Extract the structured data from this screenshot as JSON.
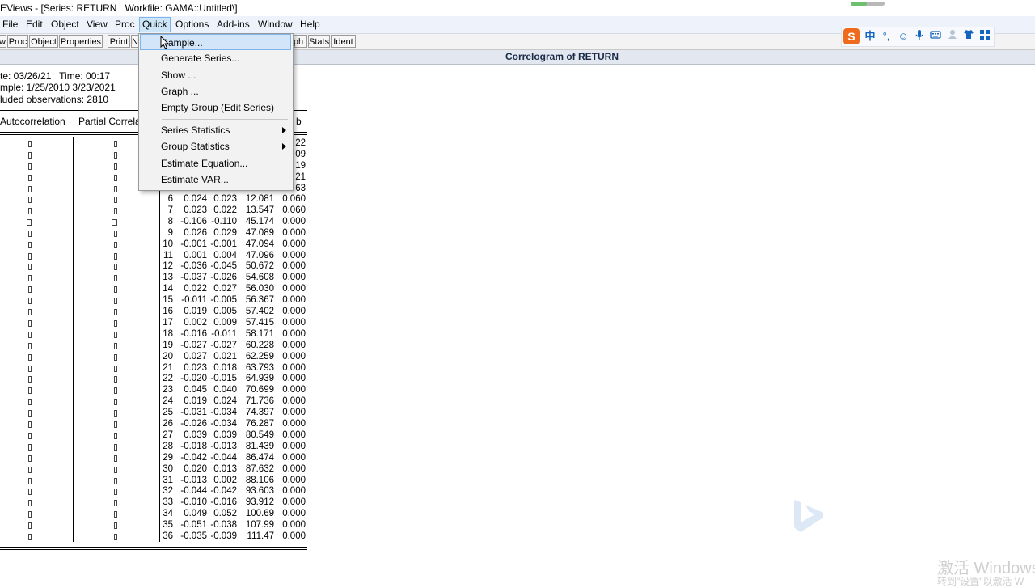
{
  "window": {
    "title": "EViews - [Series: RETURN   Workfile: GAMA::Untitled\\]",
    "view_title": "Correlogram of RETURN"
  },
  "menubar": {
    "items": [
      {
        "label": "File"
      },
      {
        "label": "Edit"
      },
      {
        "label": "Object"
      },
      {
        "label": "View"
      },
      {
        "label": "Proc"
      },
      {
        "label": "Quick"
      },
      {
        "label": "Options"
      },
      {
        "label": "Add-ins"
      },
      {
        "label": "Window"
      },
      {
        "label": "Help"
      }
    ]
  },
  "toolbar": {
    "buttons": [
      {
        "label": "w"
      },
      {
        "label": "Proc"
      },
      {
        "label": "Object"
      },
      {
        "label": "Properties"
      },
      {
        "label": "Print"
      },
      {
        "label": "N"
      },
      {
        "label": "ph"
      },
      {
        "label": "Stats"
      },
      {
        "label": "Ident"
      }
    ]
  },
  "quick_menu": {
    "items": [
      {
        "label": "Sample..."
      },
      {
        "label": "Generate Series..."
      },
      {
        "label": "Show ..."
      },
      {
        "label": "Graph ..."
      },
      {
        "label": "Empty Group (Edit Series)"
      },
      {
        "label": "Series Statistics"
      },
      {
        "label": "Group Statistics"
      },
      {
        "label": "Estimate Equation..."
      },
      {
        "label": "Estimate VAR..."
      }
    ]
  },
  "header_info": {
    "date": "te: 03/26/21   Time: 00:17",
    "sample": "mple: 1/25/2010 3/23/2021",
    "obs": "luded observations: 2810"
  },
  "columns": {
    "autocorrelation": "Autocorrelation",
    "partial": "Partial Correla",
    "prob": "b"
  },
  "partial_top_rows": [
    {
      "prob_frag": "22"
    },
    {
      "prob_frag": "09"
    },
    {
      "prob_frag": "19"
    },
    {
      "prob_frag": "21"
    },
    {
      "prob_frag": "63"
    }
  ],
  "correlogram": [
    {
      "lag": "6",
      "ac": "0.024",
      "pac": "0.023",
      "q": "12.081",
      "p": "0.060"
    },
    {
      "lag": "7",
      "ac": "0.023",
      "pac": "0.022",
      "q": "13.547",
      "p": "0.060"
    },
    {
      "lag": "8",
      "ac": "-0.106",
      "pac": "-0.110",
      "q": "45.174",
      "p": "0.000"
    },
    {
      "lag": "9",
      "ac": "0.026",
      "pac": "0.029",
      "q": "47.089",
      "p": "0.000"
    },
    {
      "lag": "10",
      "ac": "-0.001",
      "pac": "-0.001",
      "q": "47.094",
      "p": "0.000"
    },
    {
      "lag": "11",
      "ac": "0.001",
      "pac": "0.004",
      "q": "47.096",
      "p": "0.000"
    },
    {
      "lag": "12",
      "ac": "-0.036",
      "pac": "-0.045",
      "q": "50.672",
      "p": "0.000"
    },
    {
      "lag": "13",
      "ac": "-0.037",
      "pac": "-0.026",
      "q": "54.608",
      "p": "0.000"
    },
    {
      "lag": "14",
      "ac": "0.022",
      "pac": "0.027",
      "q": "56.030",
      "p": "0.000"
    },
    {
      "lag": "15",
      "ac": "-0.011",
      "pac": "-0.005",
      "q": "56.367",
      "p": "0.000"
    },
    {
      "lag": "16",
      "ac": "0.019",
      "pac": "0.005",
      "q": "57.402",
      "p": "0.000"
    },
    {
      "lag": "17",
      "ac": "0.002",
      "pac": "0.009",
      "q": "57.415",
      "p": "0.000"
    },
    {
      "lag": "18",
      "ac": "-0.016",
      "pac": "-0.011",
      "q": "58.171",
      "p": "0.000"
    },
    {
      "lag": "19",
      "ac": "-0.027",
      "pac": "-0.027",
      "q": "60.228",
      "p": "0.000"
    },
    {
      "lag": "20",
      "ac": "0.027",
      "pac": "0.021",
      "q": "62.259",
      "p": "0.000"
    },
    {
      "lag": "21",
      "ac": "0.023",
      "pac": "0.018",
      "q": "63.793",
      "p": "0.000"
    },
    {
      "lag": "22",
      "ac": "-0.020",
      "pac": "-0.015",
      "q": "64.939",
      "p": "0.000"
    },
    {
      "lag": "23",
      "ac": "0.045",
      "pac": "0.040",
      "q": "70.699",
      "p": "0.000"
    },
    {
      "lag": "24",
      "ac": "0.019",
      "pac": "0.024",
      "q": "71.736",
      "p": "0.000"
    },
    {
      "lag": "25",
      "ac": "-0.031",
      "pac": "-0.034",
      "q": "74.397",
      "p": "0.000"
    },
    {
      "lag": "26",
      "ac": "-0.026",
      "pac": "-0.034",
      "q": "76.287",
      "p": "0.000"
    },
    {
      "lag": "27",
      "ac": "0.039",
      "pac": "0.039",
      "q": "80.549",
      "p": "0.000"
    },
    {
      "lag": "28",
      "ac": "-0.018",
      "pac": "-0.013",
      "q": "81.439",
      "p": "0.000"
    },
    {
      "lag": "29",
      "ac": "-0.042",
      "pac": "-0.044",
      "q": "86.474",
      "p": "0.000"
    },
    {
      "lag": "30",
      "ac": "0.020",
      "pac": "0.013",
      "q": "87.632",
      "p": "0.000"
    },
    {
      "lag": "31",
      "ac": "-0.013",
      "pac": "0.002",
      "q": "88.106",
      "p": "0.000"
    },
    {
      "lag": "32",
      "ac": "-0.044",
      "pac": "-0.042",
      "q": "93.603",
      "p": "0.000"
    },
    {
      "lag": "33",
      "ac": "-0.010",
      "pac": "-0.016",
      "q": "93.912",
      "p": "0.000"
    },
    {
      "lag": "34",
      "ac": "0.049",
      "pac": "0.052",
      "q": "100.69",
      "p": "0.000"
    },
    {
      "lag": "35",
      "ac": "-0.051",
      "pac": "-0.038",
      "q": "107.99",
      "p": "0.000"
    },
    {
      "lag": "36",
      "ac": "-0.035",
      "pac": "-0.039",
      "q": "111.47",
      "p": "0.000"
    }
  ],
  "ime_toolbar": {
    "logo": "S",
    "lang": "中",
    "icons": [
      "punctuation-icon",
      "emoji-icon",
      "microphone-icon",
      "keyboard-icon",
      "user-icon",
      "skin-icon",
      "grid-icon"
    ]
  },
  "watermark": {
    "line1": "激活 Windows",
    "line2": "转到\"设置\"以激活 W"
  },
  "colors": {
    "menu_bg": "#eef3fb",
    "highlight": "#cde6f7",
    "highlight_border": "#7eb4ea",
    "ime_accent": "#f06a1e"
  }
}
